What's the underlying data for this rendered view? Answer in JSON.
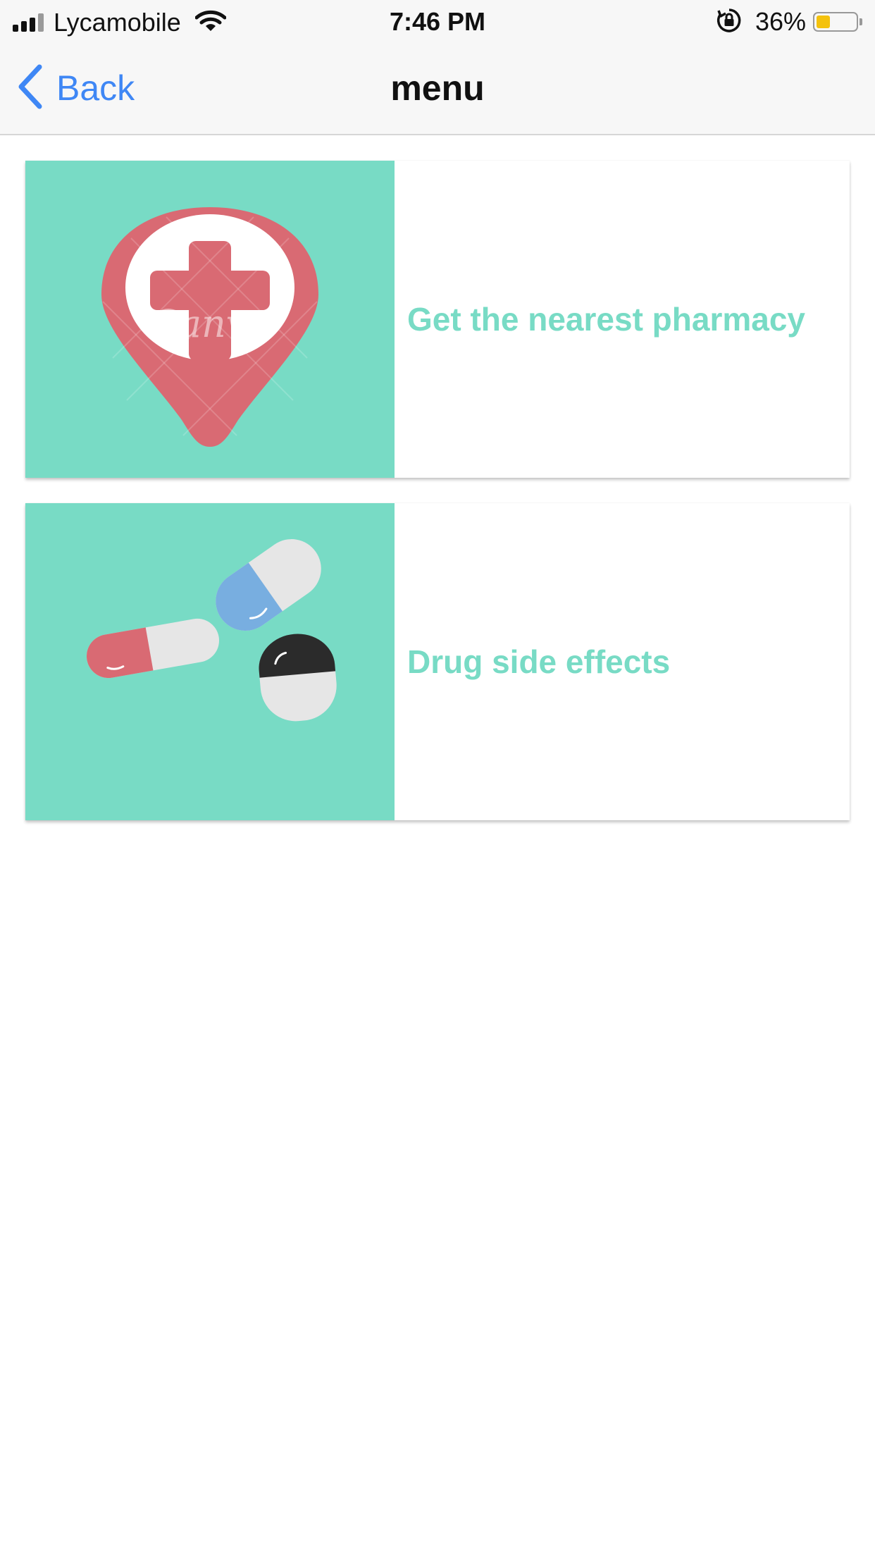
{
  "status_bar": {
    "carrier": "Lycamobile",
    "time": "7:46 PM",
    "battery_percent": "36%",
    "battery_level": 0.36,
    "battery_color": "#f4c20d",
    "icons": [
      "signal-icon",
      "wifi-icon",
      "orientation-lock-icon",
      "battery-icon"
    ]
  },
  "nav": {
    "back_label": "Back",
    "title": "menu"
  },
  "colors": {
    "accent": "#78dbc5",
    "link": "#3f87f5",
    "pin": "#d96a73"
  },
  "cards": [
    {
      "title": "Get the nearest pharmacy",
      "image": "pharmacy-location-pin-icon",
      "watermark": "Canva"
    },
    {
      "title": "Drug side effects",
      "image": "pills-icon"
    }
  ]
}
